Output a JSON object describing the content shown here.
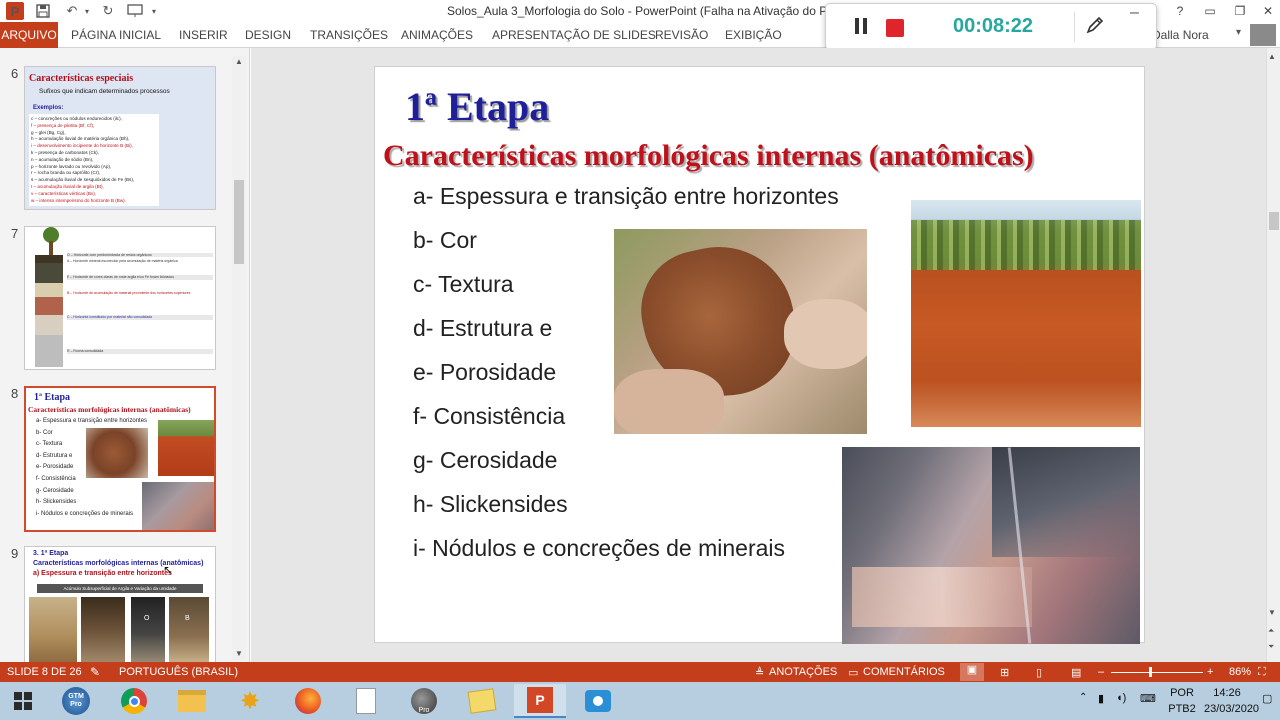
{
  "window": {
    "title": "Solos_Aula 3_Morfologia do Solo - PowerPoint (Falha na Ativação do Produto)",
    "app_icon_letter": "P"
  },
  "ribbon": {
    "file_tab": "ARQUIVO",
    "tabs": [
      "PÁGINA INICIAL",
      "INSERIR",
      "DESIGN",
      "TRANSIÇÕES",
      "ANIMAÇÕES",
      "APRESENTAÇÃO DE SLIDES",
      "REVISÃO",
      "EXIBIÇÃO"
    ],
    "user": "iglas Dalla Nora"
  },
  "recorder": {
    "time": "00:08:22"
  },
  "thumbnails": [
    {
      "num": "6",
      "title": "Características especiais",
      "subtitle": "Sufixos que indicam determinados processos",
      "heading": "Exemplos:",
      "lines": [
        "c – concreções ou nódulos endurecidos (ilc),",
        "f – presença de plintita (Bf, Cf),",
        "g – glei (Bg, Cg),",
        "h – acumulação iluvial de matéria orgânica (Bh),",
        "i – desenvolvimento incipiente do horizonte B (Bi),",
        "k – presença de carbonatos (Ck),",
        "n – acumulação de sódio (Bn),",
        "p – horizonte lavrado ou revolvido (Ap),",
        "r – rocha branda ou saprólito (Cr),",
        "s – acumulação iluvial de sesquióxidos de Fe (Bs),",
        "t – acumulação iluvial de argila (Bt),",
        "v – características vérticas (Bv),",
        "w – intenso intemperismo do horizonte B (Bw)."
      ]
    },
    {
      "num": "7",
      "lines": [
        "O – Horizonte com predominância de restos orgânicos",
        "A – Horizonte mineral escurecido pela acumulação de matéria orgânica",
        "E – Horizonte de cores claras de onde argila e/ou Fe foram lixiviados",
        "B – Horizonte de acumulação de material proviniente dos horizontes superiores",
        "C – Horizonte constituído por material não consolidado",
        "R – Rocha consolidada"
      ]
    },
    {
      "num": "8",
      "title": "1ª Etapa",
      "subtitle": "Características morfológicas internas (anatômicas)",
      "items": [
        "a- Espessura e transição entre horizontes",
        "b- Cor",
        "c- Textura",
        "d- Estrutura e",
        "e- Porosidade",
        "f- Consistência",
        "g- Cerosidade",
        "h- Slickensides",
        "i- Nódulos e concreções de minerais"
      ]
    },
    {
      "num": "9",
      "title": "3. 1ª Etapa",
      "subtitle": "Características morfológicas internas (anatômicas)",
      "line": "a) Espessura e transição entre horizontes",
      "banner": "Acúmulo Subsuperficial de Argila e Variação da umidade",
      "photo_labels": [
        "O",
        "B"
      ]
    }
  ],
  "slide": {
    "title": "1ª Etapa",
    "subtitle": "Características morfológicas internas (anatômicas)",
    "items": [
      "a- Espessura e transição entre horizontes",
      "b- Cor",
      "c- Textura",
      "d- Estrutura e",
      "e- Porosidade",
      "f- Consistência",
      "g- Cerosidade",
      "h- Slickensides",
      "i- Nódulos e concreções de minerais"
    ]
  },
  "status": {
    "slide_info": "SLIDE 8 DE 26",
    "language": "PORTUGUÊS (BRASIL)",
    "notes": "ANOTAÇÕES",
    "comments": "COMENTÁRIOS",
    "zoom": "86%"
  },
  "taskbar": {
    "lang": "POR",
    "layout": "PTB2",
    "time": "14:26",
    "date": "23/03/2020",
    "app_labels": [
      "GTM Pro",
      "Pro"
    ]
  },
  "colors": {
    "accent": "#c43e1c",
    "slide_title": "#1f1f9a",
    "slide_subtitle": "#c0101a",
    "timer": "#26a7a0"
  }
}
